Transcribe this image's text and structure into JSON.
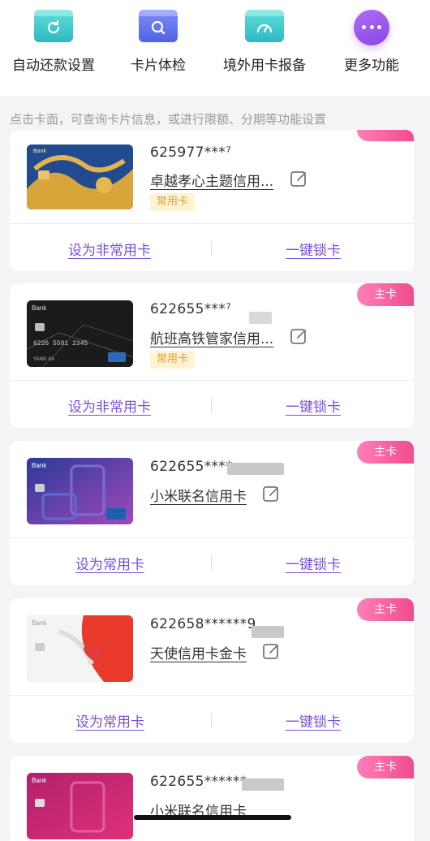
{
  "actions": [
    {
      "label": "自动还款设置",
      "icon": "auto-repay-icon"
    },
    {
      "label": "卡片体检",
      "icon": "card-check-icon"
    },
    {
      "label": "境外用卡报备",
      "icon": "overseas-gauge-icon"
    },
    {
      "label": "更多功能",
      "icon": "more-dots-icon"
    }
  ],
  "hint": "点击卡面，可查询卡片信息，或进行限额、分期等功能设置",
  "cards": [
    {
      "number": "625977***⁷",
      "name": "卓越孝心主题信用...",
      "tag": "常用卡",
      "badge": "",
      "left_action": "设为非常用卡",
      "right_action": "一键锁卡",
      "card_art_label": "Bank"
    },
    {
      "number": "622655***⁷",
      "name": "航班高铁管家信用...",
      "tag": "常用卡",
      "badge": "主卡",
      "left_action": "设为非常用卡",
      "right_action": "一键锁卡",
      "card_art_label": "Bank",
      "card_art_holder": "YANG XA"
    },
    {
      "number": "622655****",
      "name": "小米联名信用卡",
      "tag": "",
      "badge": "主卡",
      "left_action": "设为常用卡",
      "right_action": "一键锁卡",
      "card_art_label": "Bank"
    },
    {
      "number": "622658******9",
      "name": "天使信用卡金卡",
      "tag": "",
      "badge": "主卡",
      "left_action": "设为常用卡",
      "right_action": "一键锁卡",
      "card_art_label": "Bank"
    },
    {
      "number": "622655******",
      "name": "小米联名信用卡",
      "tag": "",
      "badge": "主卡",
      "left_action": "",
      "right_action": "",
      "card_art_label": "Bank"
    }
  ],
  "colors": {
    "accent_link": "#7b4fd6",
    "badge": "#f04c8c",
    "tag_bg": "#fff3d4",
    "tag_text": "#e2a033"
  }
}
